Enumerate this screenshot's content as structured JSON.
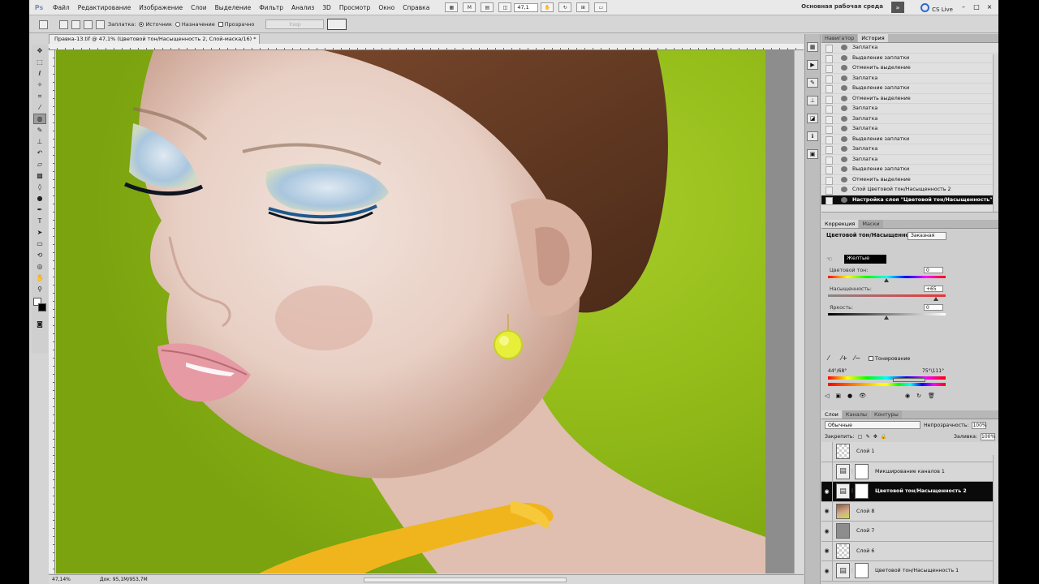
{
  "menu": {
    "app_short": "Ps",
    "items": [
      "Файл",
      "Редактирование",
      "Изображение",
      "Слои",
      "Выделение",
      "Фильтр",
      "Анализ",
      "3D",
      "Просмотр",
      "Окно",
      "Справка"
    ],
    "zoom": "47,1",
    "workspace": "Основная рабочая среда",
    "cs_live": "CS Live",
    "minimize": "–",
    "maximize": "□",
    "close": "×"
  },
  "options": {
    "patch_label": "Заплатка:",
    "source": "Источник",
    "destination": "Назначение",
    "transparent": "Прозрачно",
    "pattern": "Узор"
  },
  "document": {
    "tab_title": "Правка-13.tif @ 47,1% (Цветовой тон/Насыщенность 2, Слой-маска/16) *",
    "status_zoom": "47,14%",
    "status_doc": "Док: 95,1M/953,7M"
  },
  "history": {
    "tabs": [
      "Навигатор",
      "История"
    ],
    "items": [
      "Заплатка",
      "Выделение заплатки",
      "Отменить выделение",
      "Заплатка",
      "Выделение заплатки",
      "Отменить выделение",
      "Заплатка",
      "Заплатка",
      "Заплатка",
      "Выделение заплатки",
      "Заплатка",
      "Заплатка",
      "Выделение заплатки",
      "Отменить выделение",
      "Слой Цветовой тон/Насыщенность 2",
      "Настройка слоя \"Цветовой тон/Насыщенность\""
    ]
  },
  "adjustments": {
    "tabs": [
      "Коррекция",
      "Маски"
    ],
    "title": "Цветовой тон/Насыщенность",
    "preset": "Заказная",
    "range": "Желтые",
    "hue_label": "Цветовой тон:",
    "hue_value": "0",
    "sat_label": "Насыщенность:",
    "sat_value": "+65",
    "light_label": "Яркость:",
    "light_value": "0",
    "colorize": "Тонирование",
    "angle_left": "44°/68°",
    "angle_right": "75°\\111°"
  },
  "layers": {
    "tabs": [
      "Слои",
      "Каналы",
      "Контуры"
    ],
    "blend_mode": "Обычные",
    "opacity_label": "Непрозрачность:",
    "opacity": "100%",
    "lock_label": "Закрепить:",
    "fill_label": "Заливка:",
    "fill": "100%",
    "items": [
      {
        "name": "Слой 1",
        "visible": false
      },
      {
        "name": "Микширование каналов 1",
        "visible": false
      },
      {
        "name": "Цветовой тон/Насыщенность 2",
        "visible": true
      },
      {
        "name": "Слой 8",
        "visible": true
      },
      {
        "name": "Слой 7",
        "visible": true
      },
      {
        "name": "Слой 6",
        "visible": true
      },
      {
        "name": "Цветовой тон/Насыщенность 1",
        "visible": true
      }
    ]
  }
}
